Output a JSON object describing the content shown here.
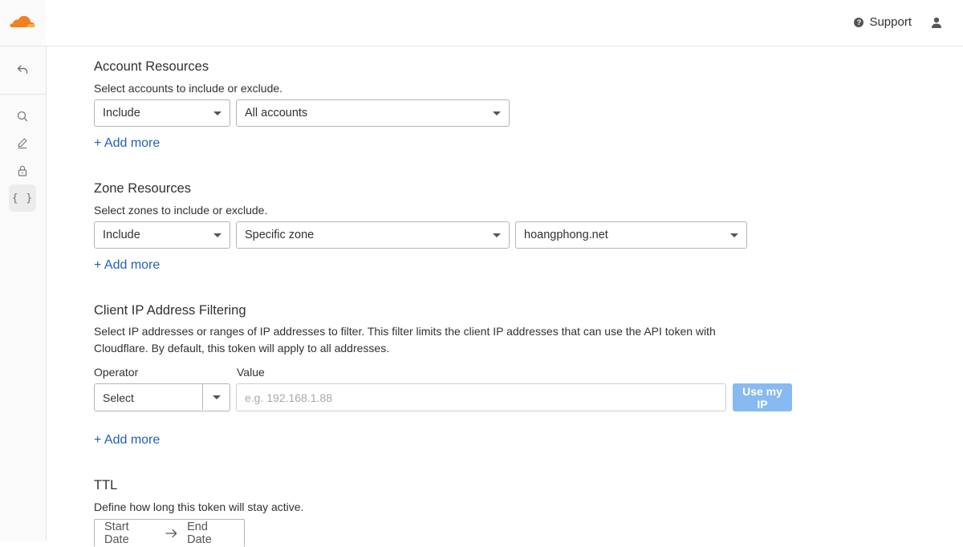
{
  "topbar": {
    "support_label": "Support",
    "support_icon": "question-circle-icon",
    "user_icon": "user-icon"
  },
  "sidebar": {
    "items": [
      {
        "name": "back",
        "icon": "back-arrow-icon"
      },
      {
        "name": "search",
        "icon": "search-icon"
      },
      {
        "name": "edit",
        "icon": "pencil-icon"
      },
      {
        "name": "lock",
        "icon": "lock-icon"
      },
      {
        "name": "api",
        "icon": "braces-icon",
        "glyph": "{ }",
        "active": true
      }
    ]
  },
  "account_resources": {
    "title": "Account Resources",
    "description": "Select accounts to include or exclude.",
    "mode": "Include",
    "scope": "All accounts",
    "add_more": "+ Add more"
  },
  "zone_resources": {
    "title": "Zone Resources",
    "description": "Select zones to include or exclude.",
    "mode": "Include",
    "scope": "Specific zone",
    "zone": "hoangphong.net",
    "add_more": "+ Add more"
  },
  "ip_filtering": {
    "title": "Client IP Address Filtering",
    "description": "Select IP addresses or ranges of IP addresses to filter. This filter limits the client IP addresses that can use the API token with Cloudflare. By default, this token will apply to all addresses.",
    "operator_label": "Operator",
    "value_label": "Value",
    "operator_value": "Select",
    "value_placeholder": "e.g. 192.168.1.88",
    "use_my_ip": "Use my IP",
    "add_more": "+ Add more"
  },
  "ttl": {
    "title": "TTL",
    "description": "Define how long this token will stay active.",
    "start_date": "Start Date",
    "end_date": "End Date"
  },
  "colors": {
    "brand_orange": "#f38020",
    "link_blue": "#1e60b8",
    "button_disabled_blue": "#87b9f3"
  }
}
